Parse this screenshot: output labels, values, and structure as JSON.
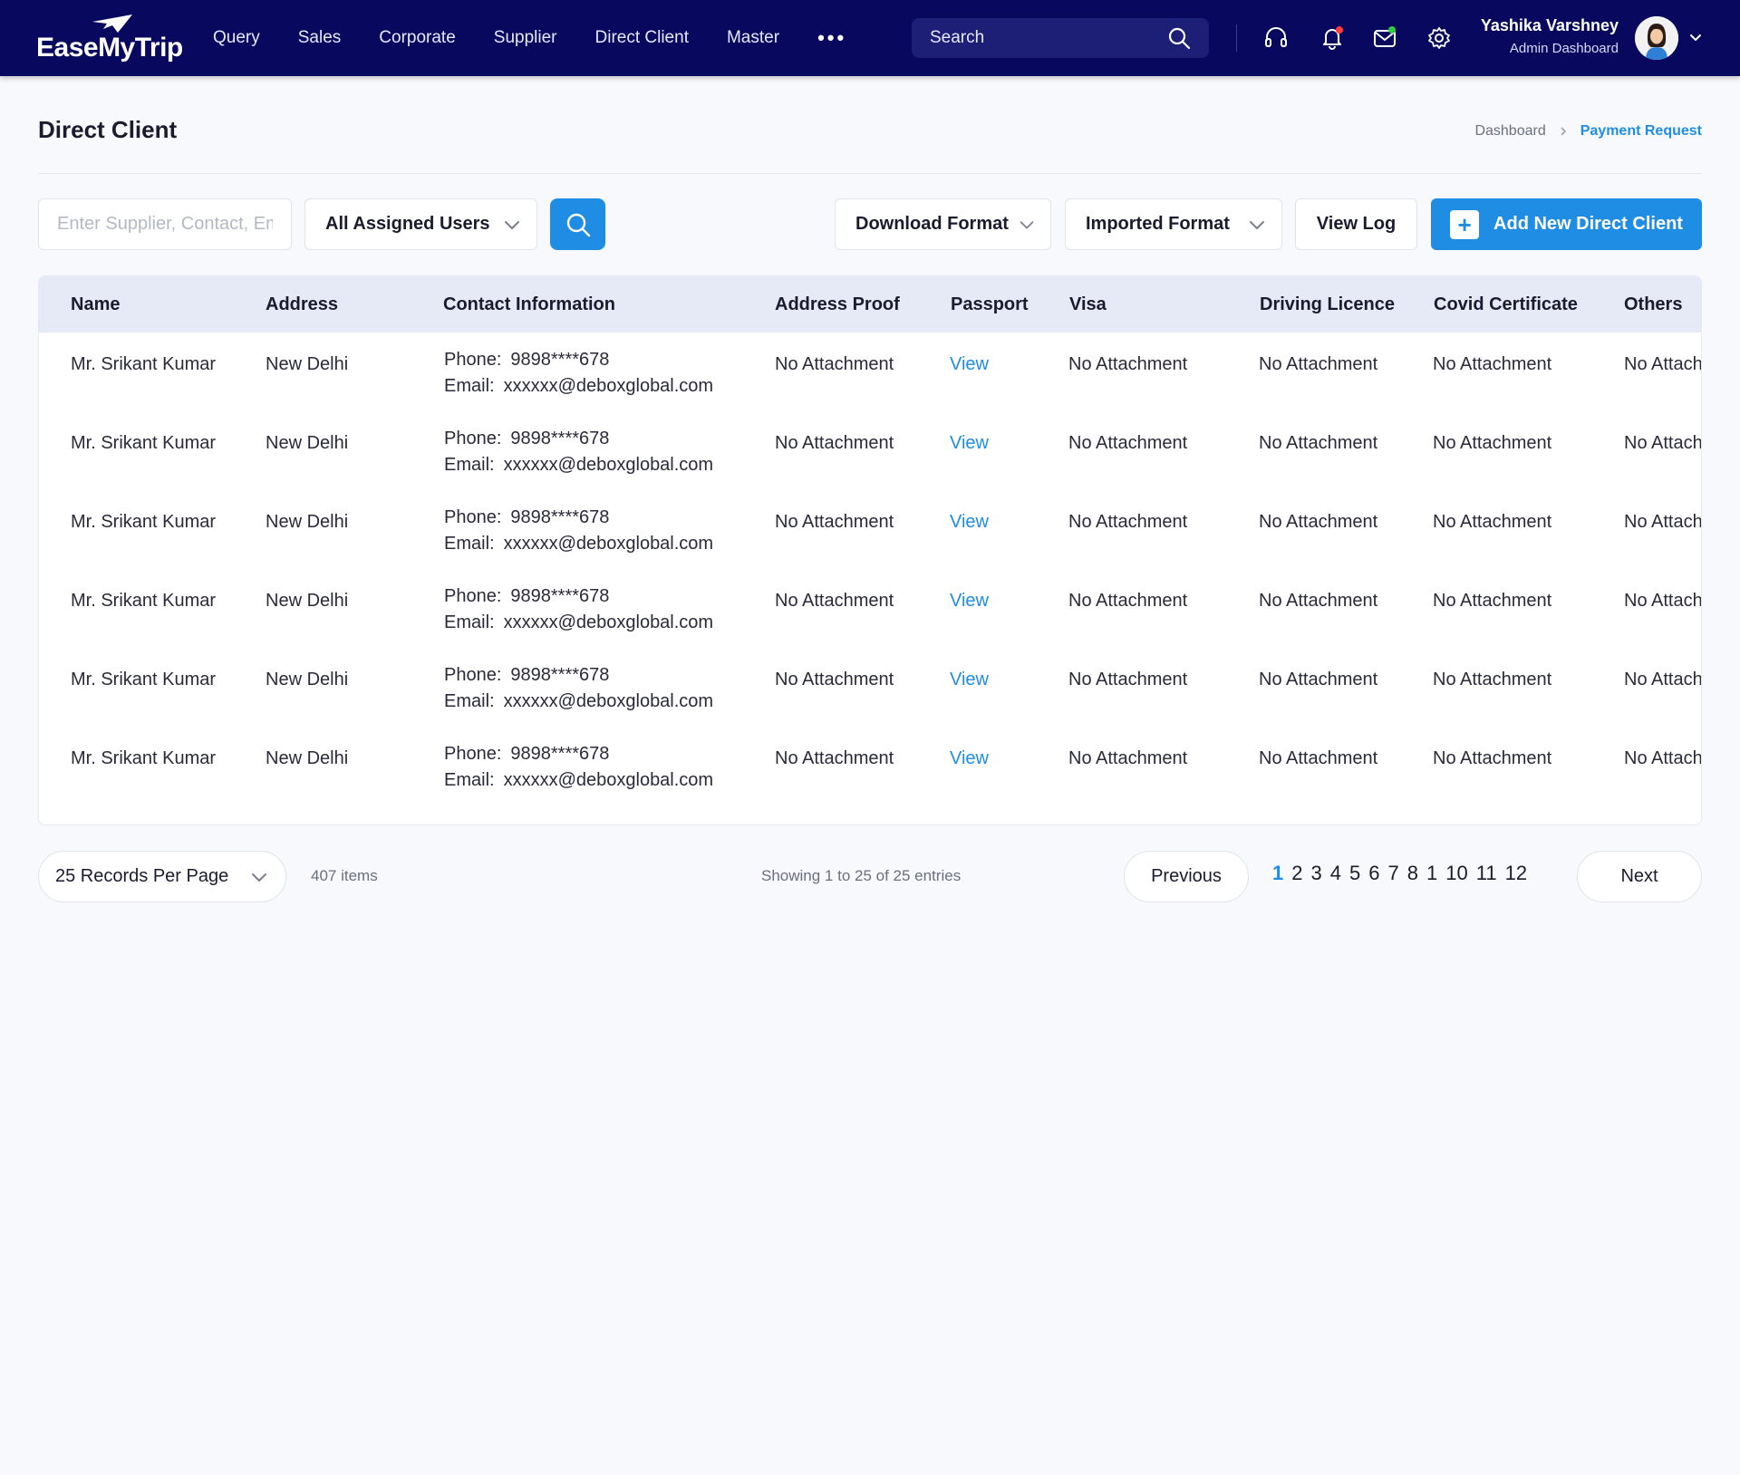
{
  "brand": {
    "logo_text": "EaseMyTrip"
  },
  "nav": {
    "items": [
      "Query",
      "Sales",
      "Corporate",
      "Supplier",
      "Direct Client",
      "Master"
    ],
    "more": "•••"
  },
  "header": {
    "search_placeholder": "Search",
    "user_name": "Yashika Varshney",
    "user_role": "Admin Dashboard"
  },
  "page": {
    "title": "Direct Client",
    "breadcrumb": {
      "parent": "Dashboard",
      "current": "Payment Request"
    }
  },
  "toolbar": {
    "filter_placeholder": "Enter Supplier, Contact, Email",
    "assigned_users": "All Assigned Users",
    "download_format": "Download Format",
    "imported_format": "Imported Format",
    "view_log": "View Log",
    "add_new": "Add New Direct Client"
  },
  "table": {
    "columns": [
      "Name",
      "Address",
      "Contact Information",
      "Address Proof",
      "Passport",
      "Visa",
      "Driving Licence",
      "Covid Certificate",
      "Others"
    ],
    "phone_label": "Phone:",
    "email_label": "Email:",
    "rows": [
      {
        "name": "Mr. Srikant Kumar",
        "address": "New Delhi",
        "phone": "9898****678",
        "email": "xxxxxx@deboxglobal.com",
        "address_proof": "No Attachment",
        "passport": "View",
        "visa": "No Attachment",
        "driving_licence": "No Attachment",
        "covid_certificate": "No Attachment",
        "others": "No Attachment"
      },
      {
        "name": "Mr. Srikant Kumar",
        "address": "New Delhi",
        "phone": "9898****678",
        "email": "xxxxxx@deboxglobal.com",
        "address_proof": "No Attachment",
        "passport": "View",
        "visa": "No Attachment",
        "driving_licence": "No Attachment",
        "covid_certificate": "No Attachment",
        "others": "No Attachment"
      },
      {
        "name": "Mr. Srikant Kumar",
        "address": "New Delhi",
        "phone": "9898****678",
        "email": "xxxxxx@deboxglobal.com",
        "address_proof": "No Attachment",
        "passport": "View",
        "visa": "No Attachment",
        "driving_licence": "No Attachment",
        "covid_certificate": "No Attachment",
        "others": "No Attachment"
      },
      {
        "name": "Mr. Srikant Kumar",
        "address": "New Delhi",
        "phone": "9898****678",
        "email": "xxxxxx@deboxglobal.com",
        "address_proof": "No Attachment",
        "passport": "View",
        "visa": "No Attachment",
        "driving_licence": "No Attachment",
        "covid_certificate": "No Attachment",
        "others": "No Attachment"
      },
      {
        "name": "Mr. Srikant Kumar",
        "address": "New Delhi",
        "phone": "9898****678",
        "email": "xxxxxx@deboxglobal.com",
        "address_proof": "No Attachment",
        "passport": "View",
        "visa": "No Attachment",
        "driving_licence": "No Attachment",
        "covid_certificate": "No Attachment",
        "others": "No Attachment"
      },
      {
        "name": "Mr. Srikant Kumar",
        "address": "New Delhi",
        "phone": "9898****678",
        "email": "xxxxxx@deboxglobal.com",
        "address_proof": "No Attachment",
        "passport": "View",
        "visa": "No Attachment",
        "driving_licence": "No Attachment",
        "covid_certificate": "No Attachment",
        "others": "No Attachment"
      }
    ]
  },
  "pagination": {
    "per_page": "25 Records Per Page",
    "items_count": "407 items",
    "showing": "Showing 1 to 25 of 25 entries",
    "previous": "Previous",
    "next": "Next",
    "pages": [
      "1",
      "2",
      "3",
      "4",
      "5",
      "6",
      "7",
      "8",
      "1",
      "10",
      "11",
      "12"
    ],
    "active_page": "1"
  },
  "colors": {
    "nav_bg": "#08085e",
    "accent": "#1f8de3",
    "bell_dot": "#ff3b3b",
    "mail_dot": "#2ecc40"
  }
}
